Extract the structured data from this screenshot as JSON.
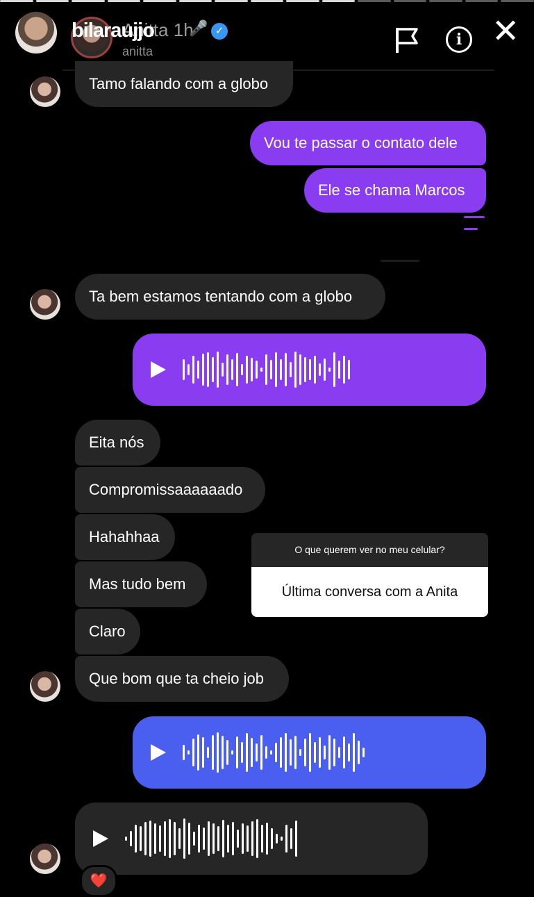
{
  "header": {
    "username": "bilaraujjo",
    "overlay_name": "Anitta",
    "time": "1h",
    "sub_name": "anitta"
  },
  "messages": {
    "m1": "Tamo falando com a globo",
    "m2": "Vou te passar o contato dele",
    "m3": "Ele se chama Marcos",
    "m4": "Ta bem estamos tentando com a globo",
    "m5": "Eita nós",
    "m6": "Compromissaaaaaado",
    "m7": "Hahahhaa",
    "m8": "Mas tudo bem",
    "m9": "Claro",
    "m10": "Que bom que ta cheio job"
  },
  "sticker": {
    "question": "O que querem ver no meu celular?",
    "answer": "Última conversa com a Anita"
  },
  "reaction": "❤️",
  "icons": [
    "microphone-icon",
    "verified-icon",
    "flag-icon",
    "info-icon",
    "close-icon",
    "play-icon",
    "heart-icon"
  ],
  "colors": {
    "outgoing_bubble": "#8a3cf0",
    "outgoing_voice_blue": "#4a5ef0",
    "incoming_bubble": "#262626",
    "background": "#000000",
    "verified": "#3897f0"
  }
}
